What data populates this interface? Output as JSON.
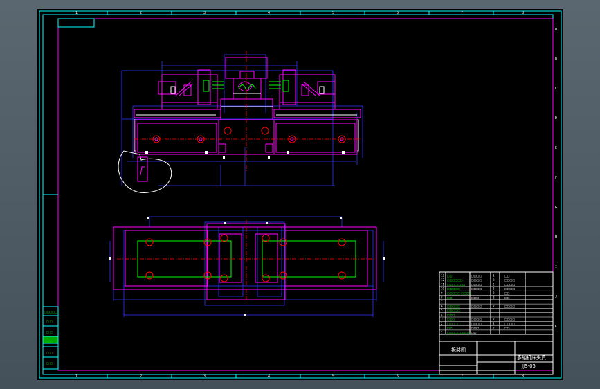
{
  "drawing": {
    "title_cn": "拆装图",
    "name_cn": "多轴机床夹具",
    "code": "JJS-05"
  },
  "frame": {
    "top_numbers": [
      "1",
      "2",
      "3",
      "4",
      "5",
      "6",
      "7",
      "8"
    ],
    "bottom_numbers": [
      "1",
      "2",
      "3",
      "4",
      "5",
      "6",
      "7",
      "8"
    ],
    "right_letters": [
      "A",
      "B",
      "C",
      "D",
      "E",
      "F",
      "G",
      "H",
      "I",
      "J",
      "K"
    ]
  },
  "bom_rows": [
    {
      "no": "13",
      "name": "□□",
      "std": "□□□□",
      "qty": "2",
      "mat": "□□"
    },
    {
      "no": "12",
      "name": "□□□□□□",
      "std": "□□□□",
      "qty": "2",
      "mat": "□□□□"
    },
    {
      "no": "11",
      "name": "□□□□□□□",
      "std": "□□□□",
      "qty": "2",
      "mat": "□□□□"
    },
    {
      "no": "10",
      "name": "□□□□□",
      "std": "□□□□",
      "qty": "2",
      "mat": "□□□□"
    },
    {
      "no": "9",
      "name": "□□□□□ □□□□",
      "std": "",
      "qty": "2",
      "mat": "□□"
    },
    {
      "no": "8",
      "name": "□□",
      "std": "□□□",
      "qty": "2",
      "mat": "□□"
    },
    {
      "no": "7",
      "name": "",
      "std": "",
      "qty": "",
      "mat": ""
    },
    {
      "no": "6",
      "name": "□□□□□",
      "std": "□□□□",
      "qty": "2",
      "mat": "□□□□"
    },
    {
      "no": "5",
      "name": "□□□□□",
      "std": "",
      "qty": "",
      "mat": ""
    },
    {
      "no": "4",
      "name": "□□□",
      "std": "",
      "qty": "",
      "mat": ""
    },
    {
      "no": "3",
      "name": "□□□",
      "std": "□□□□",
      "qty": "2",
      "mat": "□□□□"
    },
    {
      "no": "2",
      "name": "□□□□□",
      "std": "□□□□",
      "qty": "2",
      "mat": "□□□□"
    },
    {
      "no": "1",
      "name": "□□",
      "std": "□□□",
      "qty": "2",
      "mat": "□□"
    },
    {
      "no": "1",
      "name": "□□□□□□□□□",
      "std": "□□",
      "qty": "",
      "mat": ""
    }
  ],
  "side_panel": [
    "□□□□□",
    "□ □",
    "□ □",
    "□ □",
    "□ □",
    "□ □"
  ],
  "colors": {
    "frame": "#00ffff",
    "border": "#ff00ff",
    "part": "#ff00ff",
    "dim": "#3333ff",
    "center": "#ff0000",
    "green": "#00ff00",
    "white": "#ffffff",
    "yellow": "#ffff00"
  }
}
